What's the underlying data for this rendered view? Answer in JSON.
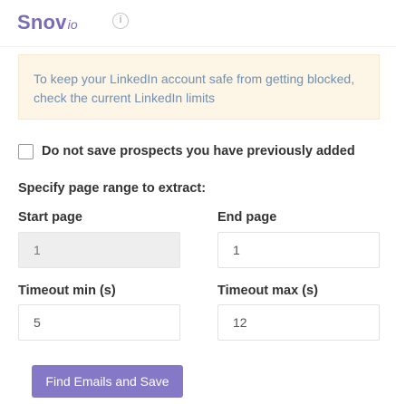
{
  "header": {
    "logo_main": "Snov",
    "logo_suffix": "io",
    "info_glyph": "i",
    "icon": "info-circle-icon"
  },
  "notice": {
    "text": "To keep your LinkedIn account safe from getting blocked, check the current LinkedIn limits"
  },
  "options": {
    "skip_previous_label": "Do not save prospects you have previously added",
    "skip_previous_checked": false
  },
  "range": {
    "heading": "Specify page range to extract:",
    "start_label": "Start page",
    "start_value": "1",
    "end_label": "End page",
    "end_value": "1"
  },
  "timeout": {
    "min_label": "Timeout min (s)",
    "min_value": "5",
    "max_label": "Timeout max (s)",
    "max_value": "12"
  },
  "actions": {
    "submit_label": "Find Emails and Save"
  },
  "colors": {
    "brand": "#7a6bb8",
    "button": "#8578c7",
    "notice_bg": "#fdf6e7",
    "notice_text": "#6f8fb3"
  }
}
